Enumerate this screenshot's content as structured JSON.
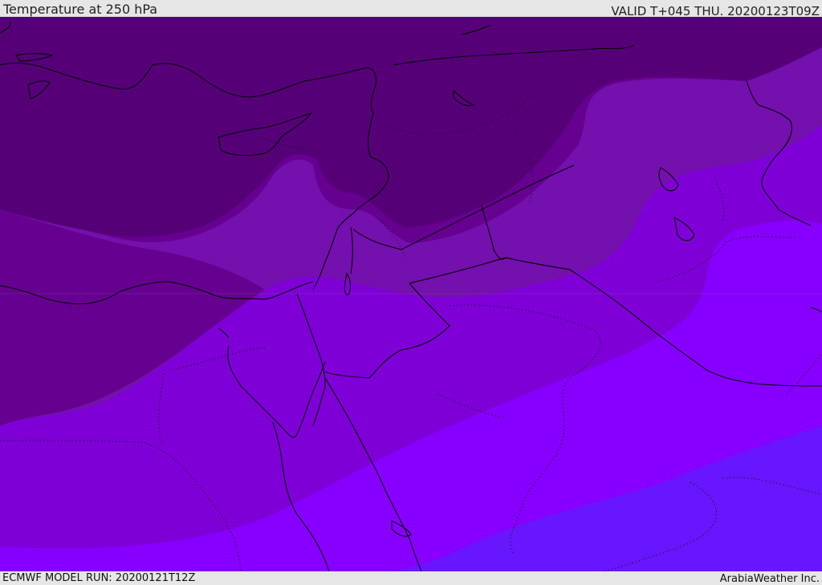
{
  "header": {
    "title": "Temperature at 250 hPa",
    "valid_time": "VALID T+045 THU. 20200123T09Z"
  },
  "footer": {
    "model_run": "ECMWF MODEL RUN: 20200121T12Z",
    "credit": "ArabiaWeather Inc."
  },
  "map": {
    "field": "Temperature at 250 hPa",
    "region": "Eastern Mediterranean / Middle East",
    "shading_colors": {
      "band_coldest": "#560078",
      "band_2": "#660090",
      "band_3": "#7410ad",
      "band_4": "#7e00d6",
      "band_5": "#8700ff",
      "band_warmest": "#6816ff"
    },
    "coastline_color": "#000000",
    "border_style": "solid and dotted black lines"
  }
}
